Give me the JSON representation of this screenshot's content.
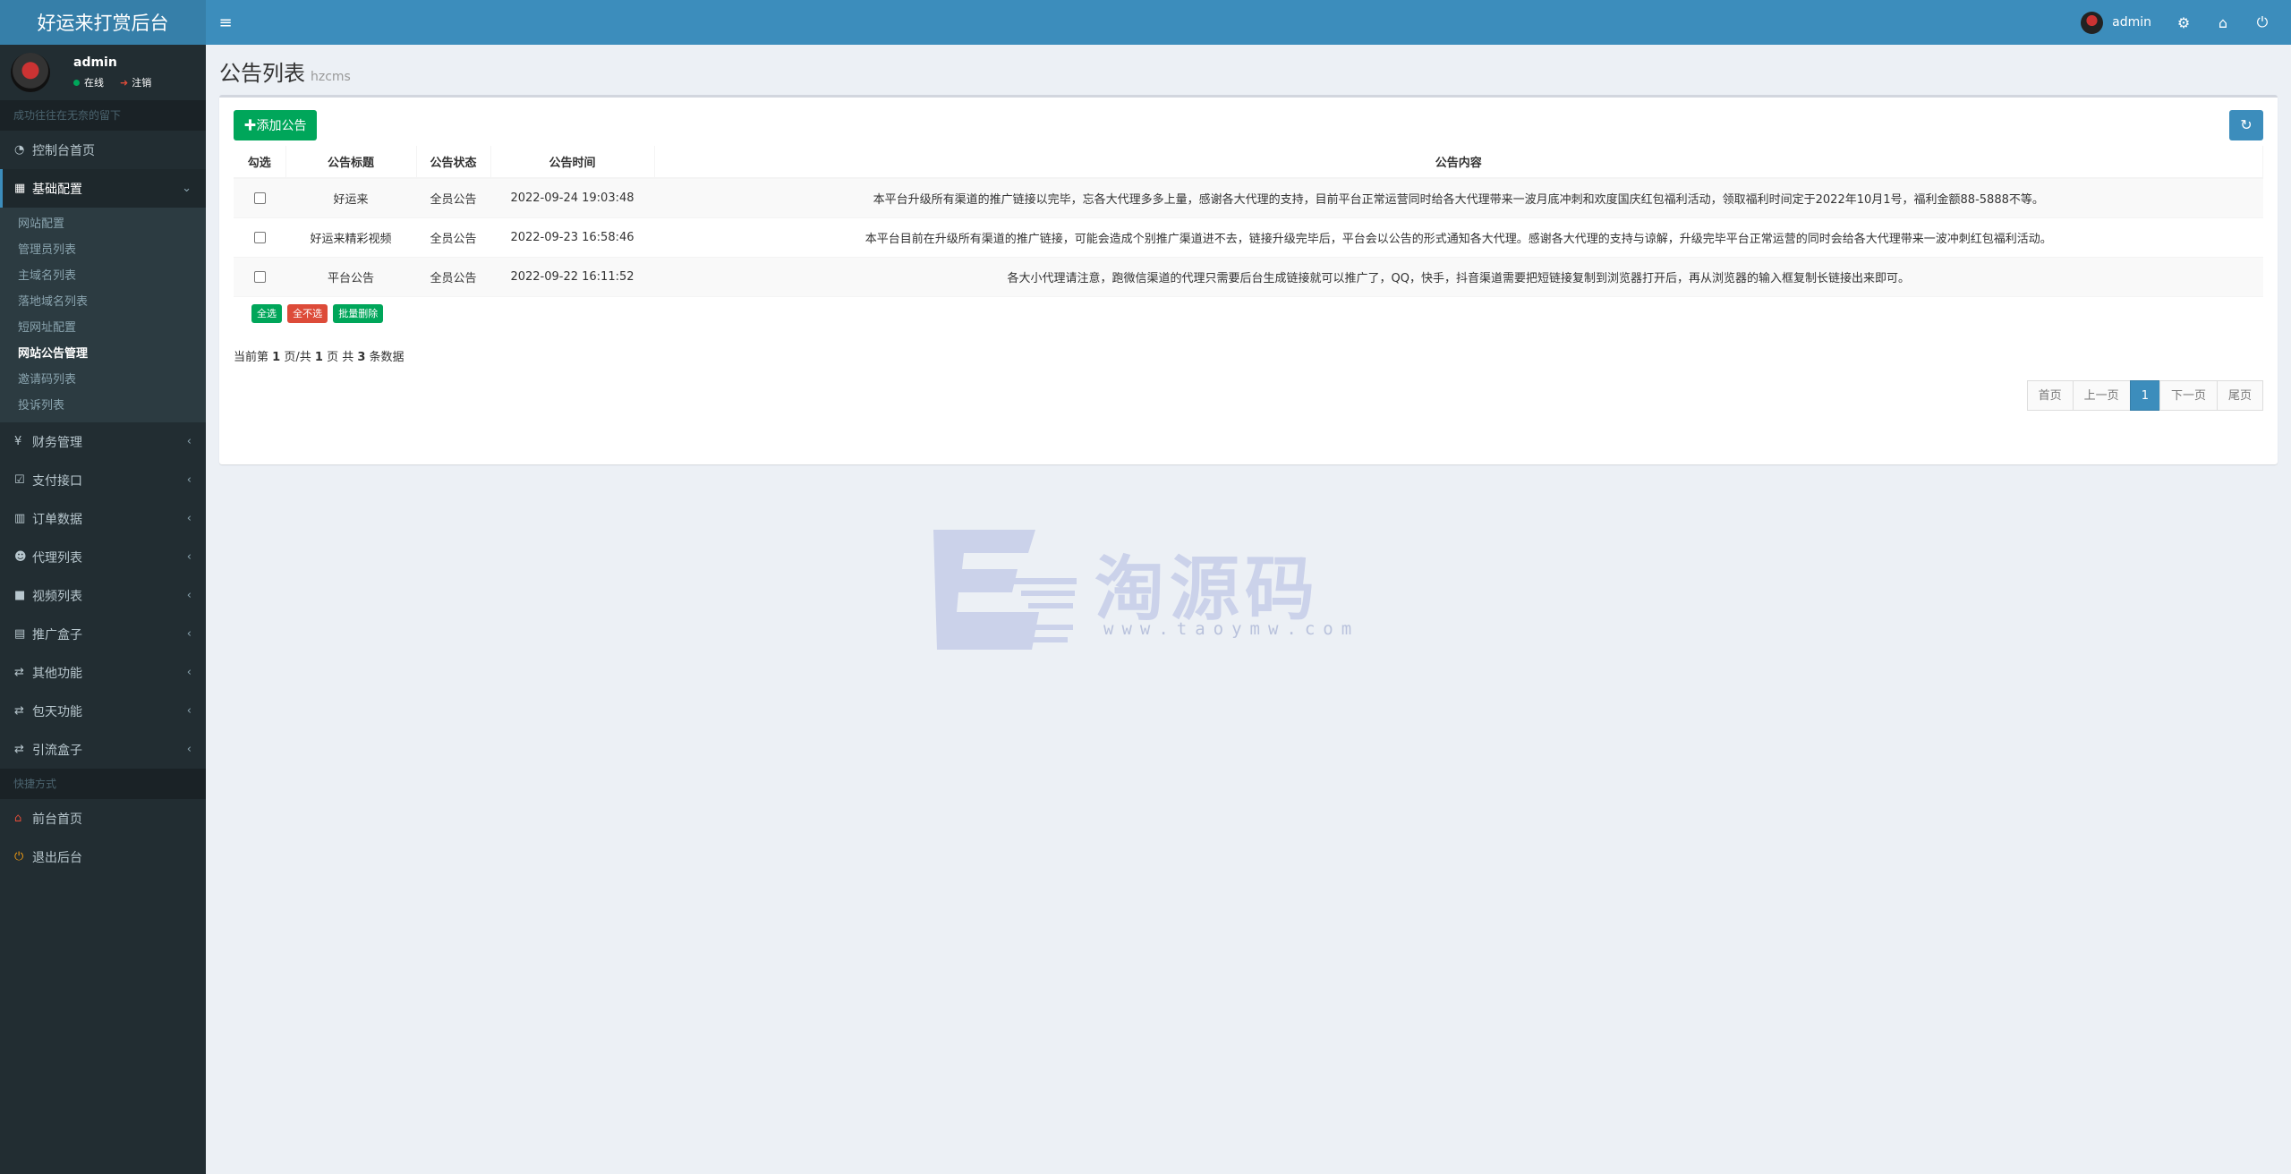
{
  "app": {
    "title": "好运来打赏后台"
  },
  "header": {
    "user": "admin"
  },
  "sidebar": {
    "user": {
      "name": "admin",
      "online": "在线",
      "logout": "注销"
    },
    "section_label": "成功往往在无奈的留下",
    "main_items": [
      {
        "label": "控制台首页"
      },
      {
        "label": "基础配置"
      },
      {
        "label": "财务管理"
      },
      {
        "label": "支付接口"
      },
      {
        "label": "订单数据"
      },
      {
        "label": "代理列表"
      },
      {
        "label": "视频列表"
      },
      {
        "label": "推广盒子"
      },
      {
        "label": "其他功能"
      },
      {
        "label": "包天功能"
      },
      {
        "label": "引流盒子"
      }
    ],
    "sub_items": [
      {
        "label": "网站配置"
      },
      {
        "label": "管理员列表"
      },
      {
        "label": "主域名列表"
      },
      {
        "label": "落地域名列表"
      },
      {
        "label": "短网址配置"
      },
      {
        "label": "网站公告管理"
      },
      {
        "label": "邀请码列表"
      },
      {
        "label": "投诉列表"
      }
    ],
    "quick_label": "快捷方式",
    "quick_items": [
      {
        "label": "前台首页"
      },
      {
        "label": "退出后台"
      }
    ]
  },
  "content": {
    "title": "公告列表",
    "subtitle": "hzcms",
    "add_button": "✚添加公告",
    "columns": [
      "勾选",
      "公告标题",
      "公告状态",
      "公告时间",
      "公告内容"
    ],
    "rows": [
      {
        "title": "好运来",
        "status": "全员公告",
        "time": "2022-09-24 19:03:48",
        "content": "本平台升级所有渠道的推广链接以完毕，忘各大代理多多上量，感谢各大代理的支持，目前平台正常运营同时给各大代理带来一波月底冲刺和欢度国庆红包福利活动，领取福利时间定于2022年10月1号，福利金额88-5888不等。"
      },
      {
        "title": "好运来精彩视频",
        "status": "全员公告",
        "time": "2022-09-23 16:58:46",
        "content": "本平台目前在升级所有渠道的推广链接，可能会造成个别推广渠道进不去，链接升级完毕后，平台会以公告的形式通知各大代理。感谢各大代理的支持与谅解，升级完毕平台正常运营的同时会给各大代理带来一波冲刺红包福利活动。"
      },
      {
        "title": "平台公告",
        "status": "全员公告",
        "time": "2022-09-22 16:11:52",
        "content": "各大小代理请注意，跑微信渠道的代理只需要后台生成链接就可以推广了，QQ，快手，抖音渠道需要把短链接复制到浏览器打开后，再从浏览器的输入框复制长链接出来即可。"
      }
    ],
    "select_all": "全选",
    "select_none": "全不选",
    "batch_delete": "批量删除",
    "page_info": {
      "prefix": "当前第",
      "current": "1",
      "mid1": "页/共",
      "total_pages": "1",
      "mid2": "页 共",
      "count": "3",
      "suffix": "条数据"
    },
    "pager": {
      "first": "首页",
      "prev": "上一页",
      "current": "1",
      "next": "下一页",
      "last": "尾页"
    }
  },
  "watermark": {
    "text": "淘源码",
    "url": "www.taoymw.com"
  },
  "colors": {
    "header": "#3c8dbc",
    "logo_bg": "#367fa9",
    "sidebar": "#222d32",
    "success": "#00a65a",
    "danger": "#dd4b39"
  }
}
